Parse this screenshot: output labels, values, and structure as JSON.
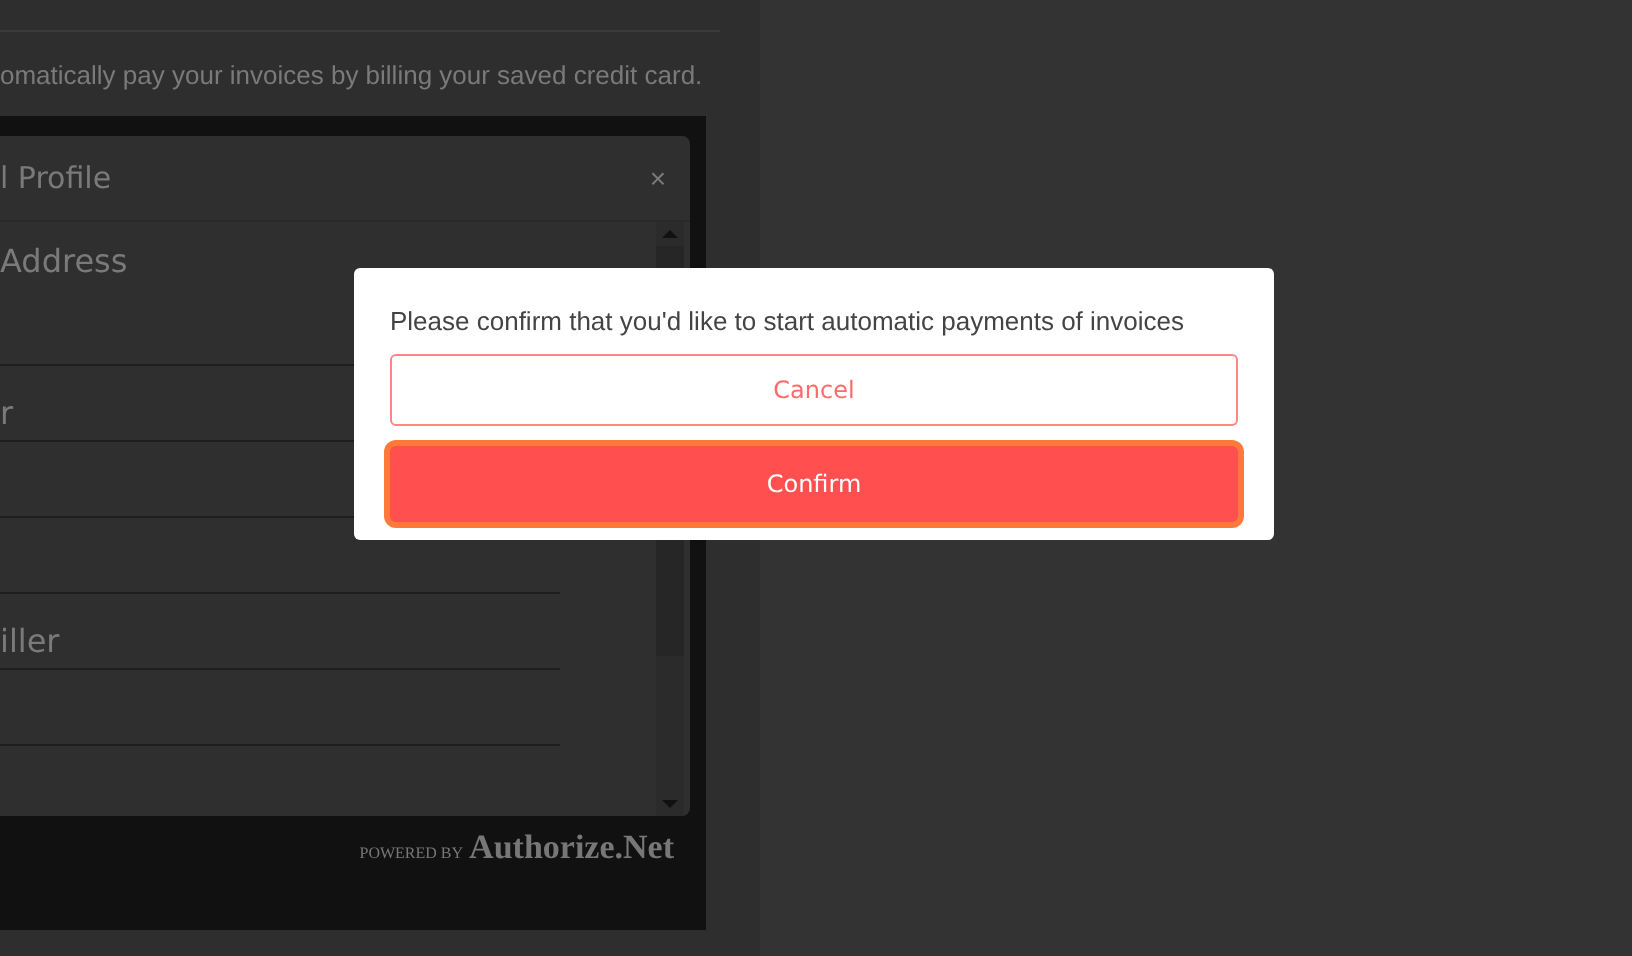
{
  "page": {
    "description": "omatically pay your invoices by billing your saved credit card.",
    "profile_panel": {
      "title": "l Profile",
      "close": "×",
      "section_heading": "Address",
      "fields": [
        {
          "kind": "blank"
        },
        {
          "kind": "labelled",
          "label": "r"
        },
        {
          "kind": "blank"
        },
        {
          "kind": "blank"
        },
        {
          "kind": "labelled",
          "label": "iller"
        },
        {
          "kind": "blank"
        }
      ]
    },
    "powered_by": {
      "prefix": "POWERED BY",
      "brand": "Authorize.Net"
    }
  },
  "dialog": {
    "message": "Please confirm that you'd like to start automatic payments of invoices",
    "buttons": [
      {
        "label": "Cancel",
        "kind": "secondary",
        "focused": false
      },
      {
        "label": "Confirm",
        "kind": "primary",
        "focused": true
      }
    ]
  }
}
